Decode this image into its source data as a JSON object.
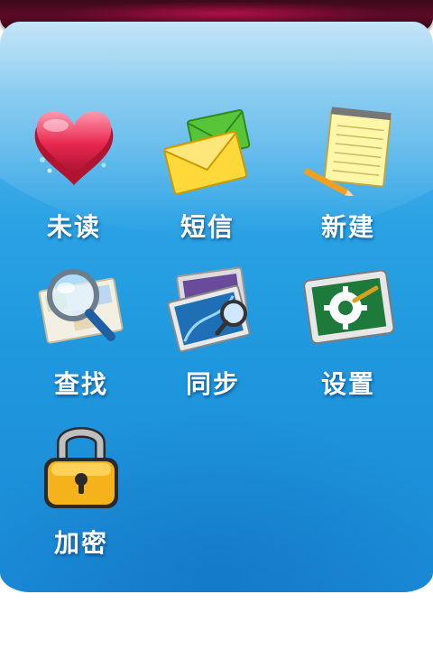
{
  "colors": {
    "topbar": "#5c0b26",
    "panel_top": "#9bd3f3",
    "panel_bottom": "#1a8ad6",
    "label_text": "#ffffff"
  },
  "menu": {
    "items": [
      {
        "label": "未读",
        "icon": "heart-box-icon"
      },
      {
        "label": "短信",
        "icon": "envelope-icon"
      },
      {
        "label": "新建",
        "icon": "notepad-icon"
      },
      {
        "label": "查找",
        "icon": "magnifier-map-icon"
      },
      {
        "label": "同步",
        "icon": "photo-sync-icon"
      },
      {
        "label": "设置",
        "icon": "gear-monitor-icon"
      },
      {
        "label": "加密",
        "icon": "padlock-icon"
      }
    ]
  }
}
